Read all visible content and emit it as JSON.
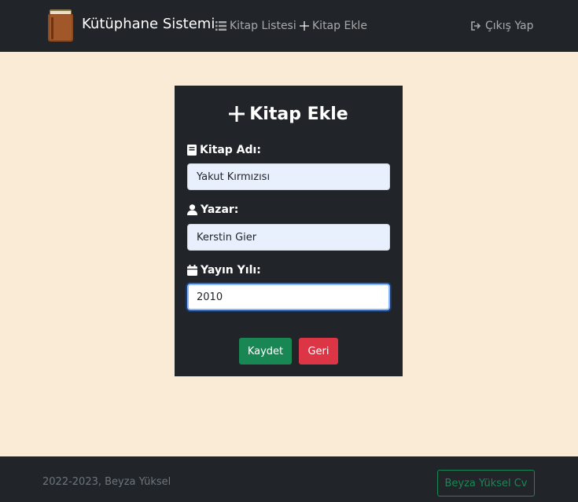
{
  "navbar": {
    "brand": "Kütüphane Sistemi",
    "links": [
      {
        "label": "Kitap Listesi",
        "icon": "list-icon"
      },
      {
        "label": "Kitap Ekle",
        "icon": "plus-icon"
      }
    ],
    "logout": {
      "label": "Çıkış Yap",
      "icon": "sign-out-icon"
    }
  },
  "form": {
    "title": "Kitap Ekle",
    "fields": [
      {
        "label": "Kitap Adı:",
        "icon": "book-icon",
        "value": "Yakut Kırmızısı"
      },
      {
        "label": "Yazar:",
        "icon": "user-icon",
        "value": "Kerstin Gier"
      },
      {
        "label": "Yayın Yılı:",
        "icon": "calendar-icon",
        "value": "2010"
      }
    ],
    "save_label": "Kaydet",
    "back_label": "Geri"
  },
  "footer": {
    "copyright": "2022-2023, Beyza Yüksel",
    "cv_label": "Beyza Yüksel Cv"
  },
  "colors": {
    "page_bg": "#faebd7",
    "dark": "#212529",
    "success": "#198754",
    "danger": "#dc3545",
    "autofill_bg": "#e8f0fe"
  }
}
